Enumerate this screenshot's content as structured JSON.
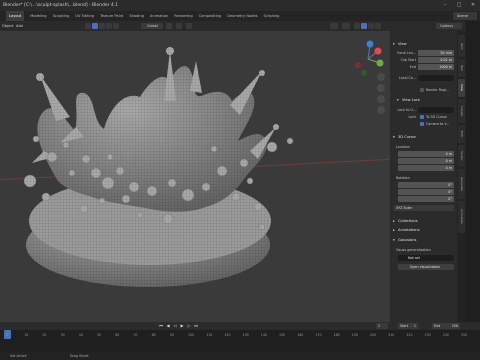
{
  "window": {
    "title": "Blender* [C:\\...\\sculpt-splash\\...blend] - Blender 4.1"
  },
  "menu": {
    "items": [
      "Layout",
      "Modeling",
      "Sculpting",
      "UV Editing",
      "Texture Paint",
      "Shading",
      "Animation",
      "Rendering",
      "Compositing",
      "Geometry Nodes",
      "Scripting"
    ],
    "active_index": 0,
    "scene": "Scene"
  },
  "header3d": {
    "mode": "Object",
    "add": "Add",
    "orientation": "Global",
    "options": "Options"
  },
  "npanel": {
    "view_title": "View",
    "focal_label": "Focal Len...",
    "focal_value": "50 mm",
    "clip_start_label": "Clip Start",
    "clip_start_value": "0.01 m",
    "clip_end_label": "End",
    "clip_end_value": "1000 m",
    "local_camera_label": "Local Ca...",
    "render_region_label": "Render Regi...",
    "view_lock_title": "View Lock",
    "lock_object_label": "Lock to O...",
    "lock_label": "Lock",
    "to_3d_cursor_label": "To 3D Cursor",
    "camera_to_view_label": "Camera to V...",
    "cursor_title": "3D Cursor",
    "location_label": "Location",
    "loc_x": "0 m",
    "loc_y": "0 m",
    "loc_z": "0 m",
    "rotation_label": "Rotation",
    "rot_x": "0°",
    "rot_y": "0°",
    "rot_z": "0°",
    "rot_mode": "XYZ Euler",
    "collections_title": "Collections",
    "annotations_title": "Annotations",
    "gaussians_title": "Gaussians",
    "gauss_label": "Gauss generalization",
    "not_set_label": "Not set",
    "open_button": "Open visualization"
  },
  "sidetabs": [
    "Item",
    "Tool",
    "View",
    "Create",
    "Edit",
    "Sculpt",
    "Generate",
    "Animation"
  ],
  "timeline": {
    "ticks": [
      "0",
      "10",
      "20",
      "30",
      "40",
      "50",
      "60",
      "70",
      "80",
      "90",
      "100",
      "110",
      "120",
      "130",
      "140",
      "150",
      "160",
      "170",
      "180",
      "190",
      "200",
      "210",
      "220",
      "230",
      "240",
      "250"
    ],
    "current": "1",
    "start_label": "Start",
    "start": "1",
    "end_label": "End",
    "end": "250"
  },
  "status": {
    "left": "Set Active",
    "mid": "Drag Sheet"
  },
  "colors": {
    "accent": "#4a72b8",
    "mesh": "#a7a7a7",
    "viewport": "#3a3a3a",
    "x_axis": "#e34b54",
    "y_axis": "#6fae3a",
    "z_axis": "#3f7fd6"
  }
}
